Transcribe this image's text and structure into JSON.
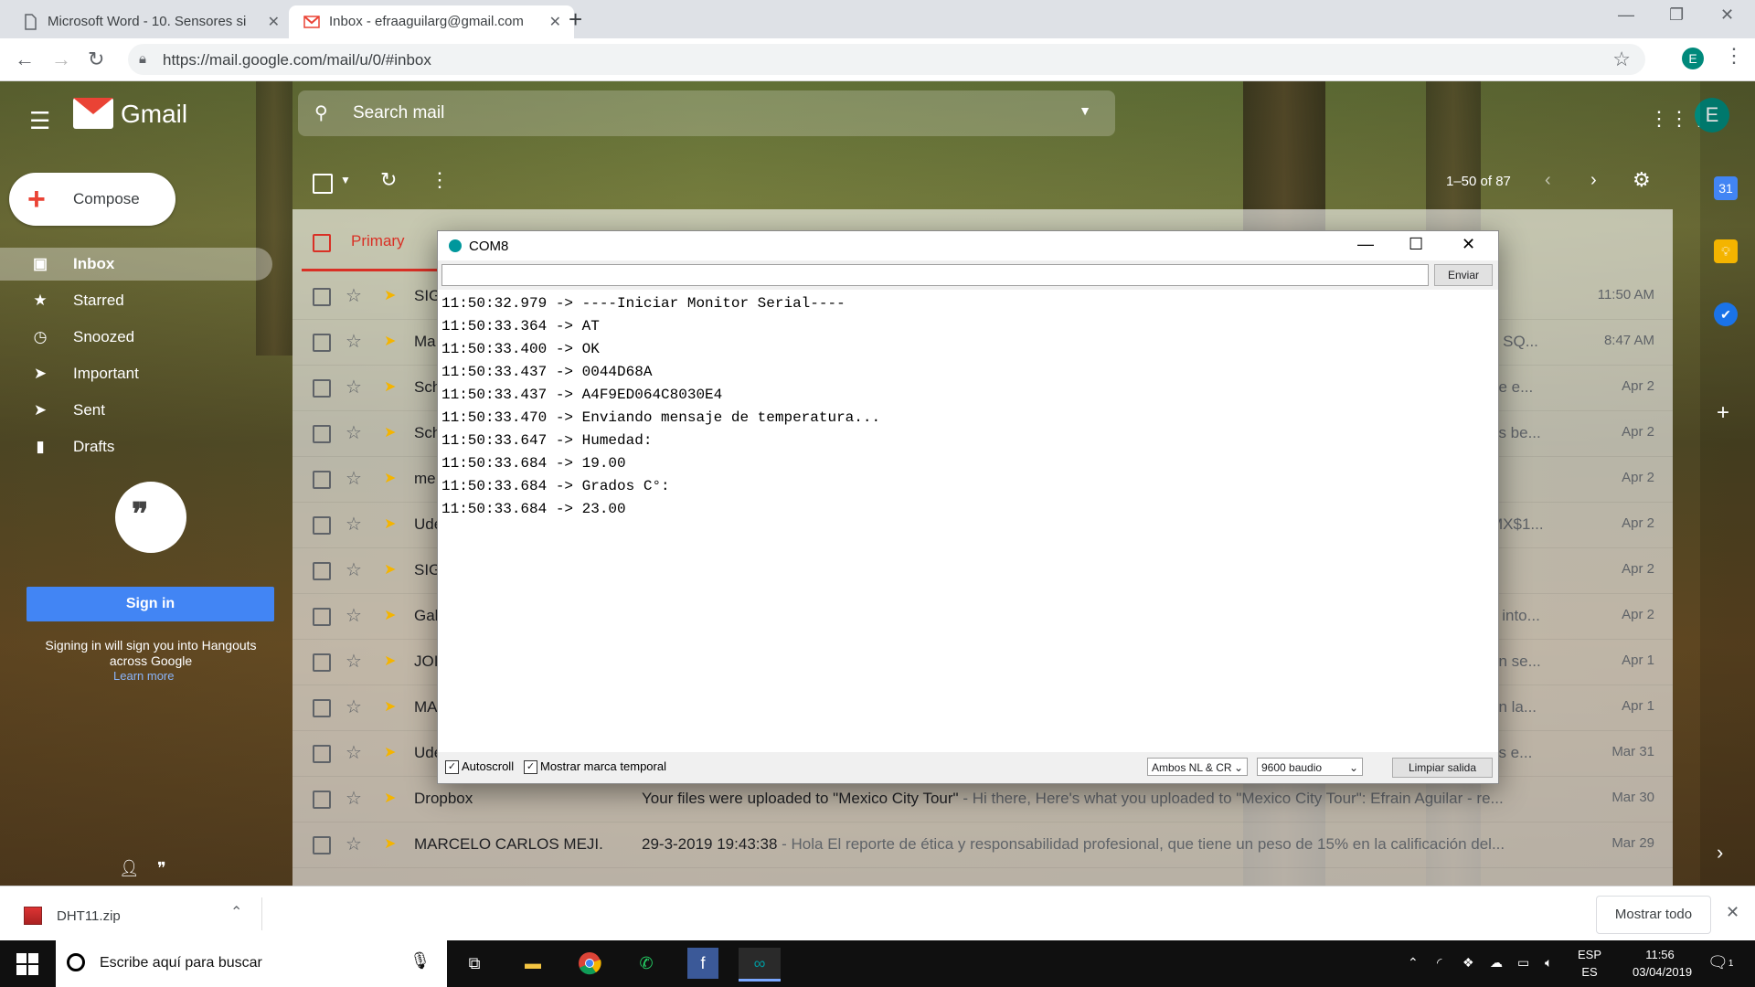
{
  "browser": {
    "tabs": [
      {
        "title": "Microsoft Word - 10. Sensores si",
        "close": "✕"
      },
      {
        "title": "Inbox - efraaguilarg@gmail.com",
        "close": "✕"
      }
    ],
    "new_tab": "+",
    "url": "https://mail.google.com/mail/u/0/#inbox",
    "profile_initial": "E"
  },
  "gmail": {
    "brand": "Gmail",
    "search_placeholder": "Search mail",
    "account_initial": "E",
    "compose_label": "Compose",
    "nav": [
      {
        "label": "Inbox",
        "icon": "inbox-icon",
        "glyph": "▣"
      },
      {
        "label": "Starred",
        "icon": "star-icon",
        "glyph": "★"
      },
      {
        "label": "Snoozed",
        "icon": "clock-icon",
        "glyph": "◷"
      },
      {
        "label": "Important",
        "icon": "important-icon",
        "glyph": "➤"
      },
      {
        "label": "Sent",
        "icon": "send-icon",
        "glyph": "➤"
      },
      {
        "label": "Drafts",
        "icon": "draft-icon",
        "glyph": "▮"
      }
    ],
    "hangouts": {
      "signin_label": "Sign in",
      "note": "Signing in will sign you into Hangouts across Google",
      "learn_more": "Learn more"
    },
    "pager": "1–50 of 87",
    "primary_tab": "Primary",
    "rows": [
      {
        "sender": "SIG",
        "subject": "",
        "snippet": "",
        "tail": "",
        "date": "11:50 AM"
      },
      {
        "sender": "Ma",
        "subject": "",
        "snippet": "",
        "tail": "e SQ...",
        "date": "8:47 AM"
      },
      {
        "sender": "Sch",
        "subject": "",
        "snippet": "",
        "tail": "ne e...",
        "date": "Apr 2"
      },
      {
        "sender": "Sch",
        "subject": "",
        "snippet": "",
        "tail": "as be...",
        "date": "Apr 2"
      },
      {
        "sender": "me",
        "subject": "",
        "snippet": "",
        "tail": "",
        "date": "Apr 2"
      },
      {
        "sender": "Ude",
        "subject": "",
        "snippet": "",
        "tail": "MX$1...",
        "date": "Apr 2"
      },
      {
        "sender": "SIG",
        "subject": "",
        "snippet": "",
        "tail": "",
        "date": "Apr 2"
      },
      {
        "sender": "Gab",
        "subject": "",
        "snippet": "",
        "tail": "s into...",
        "date": "Apr 2"
      },
      {
        "sender": "JOI",
        "subject": "",
        "snippet": "",
        "tail": "ón se...",
        "date": "Apr 1"
      },
      {
        "sender": "MA",
        "subject": "",
        "snippet": "",
        "tail": "en la...",
        "date": "Apr 1"
      },
      {
        "sender": "Ude",
        "subject": "",
        "snippet": "",
        "tail": "es e...",
        "date": "Mar 31"
      },
      {
        "sender": "Dropbox",
        "subject": "Your files were uploaded to \"Mexico City Tour\"",
        "snippet": " - Hi there, Here's what you uploaded to \"Mexico City Tour\": Efrain Aguilar - re...",
        "tail": "",
        "date": "Mar 30"
      },
      {
        "sender": "MARCELO CARLOS MEJI.",
        "subject": "29-3-2019 19:43:38",
        "snippet": " - Hola El reporte de ética y responsabilidad profesional, que tiene un peso de 15% en la calificación del...",
        "tail": "",
        "date": "Mar 29"
      }
    ]
  },
  "serial_monitor": {
    "title": "COM8",
    "send_label": "Enviar",
    "lines": [
      "11:50:32.979 -> ----Iniciar Monitor Serial----",
      "11:50:33.364 -> AT",
      "11:50:33.400 -> OK",
      "11:50:33.437 -> 0044D68A",
      "11:50:33.437 -> A4F9ED064C8030E4",
      "11:50:33.470 -> Enviando mensaje de temperatura...",
      "11:50:33.647 -> Humedad:",
      "11:50:33.684 -> 19.00",
      "11:50:33.684 -> Grados C°:",
      "11:50:33.684 -> 23.00"
    ],
    "autoscroll_label": "Autoscroll",
    "timestamp_label": "Mostrar marca temporal",
    "line_ending": "Ambos NL & CR",
    "baud": "9600 baudio",
    "clear_label": "Limpiar salida"
  },
  "downloads": {
    "file": "DHT11.zip",
    "show_all": "Mostrar todo"
  },
  "taskbar": {
    "search_placeholder": "Escribe aquí para buscar",
    "lang_top": "ESP",
    "lang_bottom": "ES",
    "time": "11:56",
    "date": "03/04/2019",
    "notif_count": "1"
  }
}
